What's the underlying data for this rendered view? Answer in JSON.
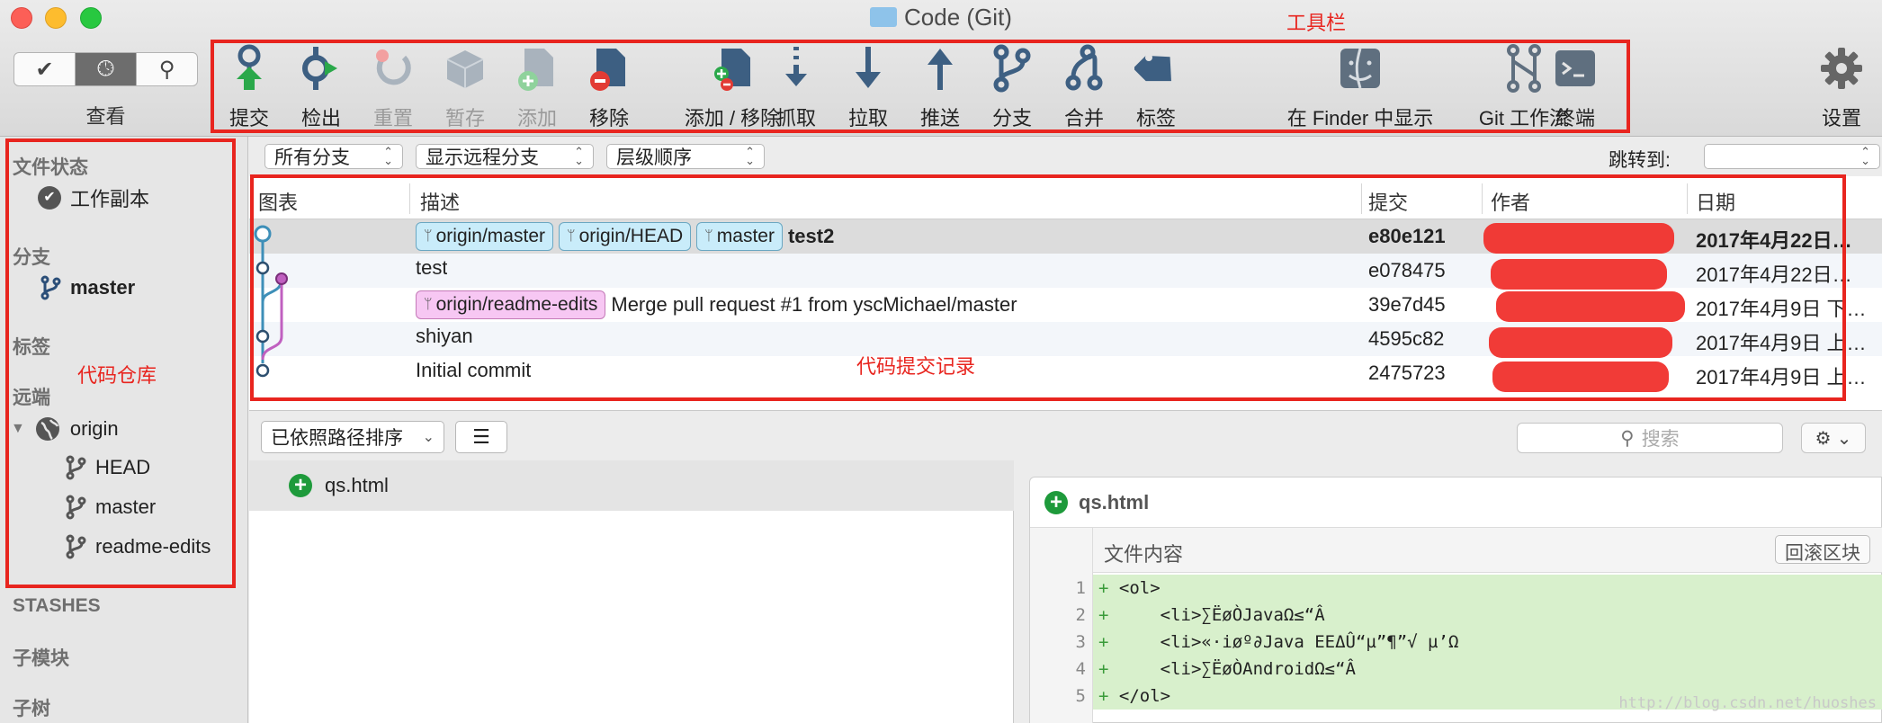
{
  "window": {
    "title": "Code (Git)"
  },
  "view_switcher": {
    "label": "查看"
  },
  "toolbar": {
    "items": [
      {
        "label": "提交",
        "icon": "commit-icon",
        "enabled": true
      },
      {
        "label": "检出",
        "icon": "checkout-icon",
        "enabled": true
      },
      {
        "label": "重置",
        "icon": "reset-icon",
        "enabled": false
      },
      {
        "label": "暂存",
        "icon": "stash-icon",
        "enabled": false
      },
      {
        "label": "添加",
        "icon": "add-icon",
        "enabled": false
      },
      {
        "label": "移除",
        "icon": "remove-icon",
        "enabled": true
      },
      {
        "label": "添加 / 移除",
        "icon": "add-remove-icon",
        "enabled": true
      },
      {
        "label": "抓取",
        "icon": "fetch-icon",
        "enabled": true
      },
      {
        "label": "拉取",
        "icon": "pull-icon",
        "enabled": true
      },
      {
        "label": "推送",
        "icon": "push-icon",
        "enabled": true
      },
      {
        "label": "分支",
        "icon": "branch-icon",
        "enabled": true
      },
      {
        "label": "合并",
        "icon": "merge-icon",
        "enabled": true
      },
      {
        "label": "标签",
        "icon": "tag-icon",
        "enabled": true
      },
      {
        "label": "在 Finder 中显示",
        "icon": "finder-icon",
        "enabled": true
      },
      {
        "label": "Git 工作流",
        "icon": "git-flow-icon",
        "enabled": true
      },
      {
        "label": "终端",
        "icon": "terminal-icon",
        "enabled": true
      }
    ],
    "settings_label": "设置"
  },
  "annotations": {
    "toolbar": "工具栏",
    "repo": "代码仓库",
    "history": "代码提交记录"
  },
  "sidebar": {
    "file_status_header": "文件状态",
    "working_copy": "工作副本",
    "branches_header": "分支",
    "branch_master": "master",
    "tags_header": "标签",
    "remotes_header": "远端",
    "remote_origin": "origin",
    "remote_branches": [
      "HEAD",
      "master",
      "readme-edits"
    ],
    "stashes_header": "STASHES",
    "submodules_header": "子模块",
    "subtrees_header": "子树"
  },
  "filters": {
    "branches": "所有分支",
    "remote": "显示远程分支",
    "order": "层级顺序",
    "jump_label": "跳转到:"
  },
  "history": {
    "columns": [
      "图表",
      "描述",
      "提交",
      "作者",
      "日期"
    ],
    "rows": [
      {
        "refs": [
          {
            "name": "origin/master",
            "style": "blue"
          },
          {
            "name": "origin/HEAD",
            "style": "blue"
          },
          {
            "name": "master",
            "style": "blue"
          }
        ],
        "message": "test2",
        "commit": "e80e121",
        "date": "2017年4月22日…"
      },
      {
        "refs": [],
        "message": "test",
        "commit": "e078475",
        "date": "2017年4月22日…"
      },
      {
        "refs": [
          {
            "name": "origin/readme-edits",
            "style": "pink"
          }
        ],
        "message": "Merge pull request #1 from yscMichael/master",
        "commit": "39e7d45",
        "date": "2017年4月9日 下…"
      },
      {
        "refs": [],
        "message": "shiyan",
        "commit": "4595c82",
        "date": "2017年4月9日 上…"
      },
      {
        "refs": [],
        "message": "Initial commit",
        "commit": "2475723",
        "date": "2017年4月9日 上…"
      }
    ]
  },
  "lower": {
    "sort_label": "已依照路径排序",
    "search_placeholder": "搜索",
    "file_name": "qs.html"
  },
  "diff": {
    "file_name": "qs.html",
    "hunk_label": "文件内容",
    "rollback_label": "回滚区块",
    "lines": [
      {
        "n": "1",
        "text": "<ol>"
      },
      {
        "n": "2",
        "text": "    <li>∑ËøÒJavaΩ≤“Â"
      },
      {
        "n": "3",
        "text": "    <li>«·iøº∂Java EEΔÛ“µ”¶”√ µ’Ω"
      },
      {
        "n": "4",
        "text": "    <li>∑ËøÒAndroidΩ≤“Â"
      },
      {
        "n": "5",
        "text": "</ol>"
      }
    ]
  },
  "watermark": "http://blog.csdn.net/huoshes"
}
